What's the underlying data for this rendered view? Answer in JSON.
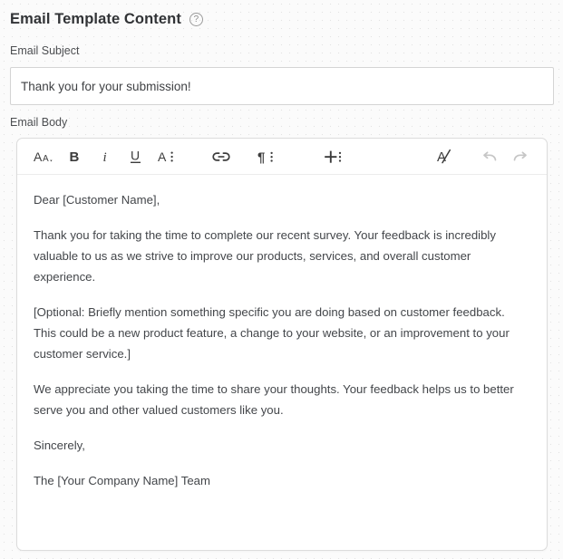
{
  "section": {
    "title": "Email Template Content",
    "help_icon": "help-circle-icon",
    "help_glyph": "?"
  },
  "fields": {
    "subject": {
      "label": "Email Subject",
      "value": "Thank you for your submission!",
      "placeholder": "Email Subject"
    },
    "body": {
      "label": "Email Body"
    }
  },
  "toolbar": {
    "items": [
      {
        "name": "text-style-icon",
        "label": "Aa",
        "tooltip": "Text style",
        "disabled": false
      },
      {
        "name": "bold-icon",
        "label": "B",
        "tooltip": "Bold",
        "disabled": false
      },
      {
        "name": "italic-icon",
        "label": "i",
        "tooltip": "Italic",
        "disabled": false
      },
      {
        "name": "underline-icon",
        "label": "U",
        "tooltip": "Underline",
        "disabled": false
      },
      {
        "name": "font-color-menu-icon",
        "label": "A",
        "tooltip": "Text formatting",
        "disabled": false
      },
      {
        "name": "link-icon",
        "label": "",
        "tooltip": "Insert link",
        "disabled": false
      },
      {
        "name": "paragraph-menu-icon",
        "label": "¶",
        "tooltip": "Paragraph",
        "disabled": false
      },
      {
        "name": "insert-menu-icon",
        "label": "+",
        "tooltip": "Insert",
        "disabled": false
      },
      {
        "name": "clear-formatting-icon",
        "label": "A",
        "tooltip": "Clear formatting",
        "disabled": false
      },
      {
        "name": "undo-icon",
        "label": "",
        "tooltip": "Undo",
        "disabled": true
      },
      {
        "name": "redo-icon",
        "label": "",
        "tooltip": "Redo",
        "disabled": true
      }
    ]
  },
  "email_body": {
    "paragraphs": [
      "Dear [Customer Name],",
      "Thank you for taking the time to complete our recent survey. Your feedback is incredibly valuable to us as we strive to improve our products, services, and overall customer experience.",
      "[Optional: Briefly mention something specific you are doing based on customer feedback. This could be a new product feature, a change to your website, or an improvement to your customer service.]",
      "We appreciate you taking the time to share your thoughts. Your feedback helps us to better serve you and other valued customers like you.",
      "Sincerely,",
      "The [Your Company Name] Team"
    ]
  },
  "colors": {
    "page_background": "#fbfbfb",
    "card_background": "#ffffff",
    "border": "#dcdcdc",
    "heading_text": "#313336",
    "label_text": "#4c4e51",
    "body_text": "#43464a",
    "icon": "#3c3c3c",
    "icon_disabled": "#c6c6c6"
  }
}
